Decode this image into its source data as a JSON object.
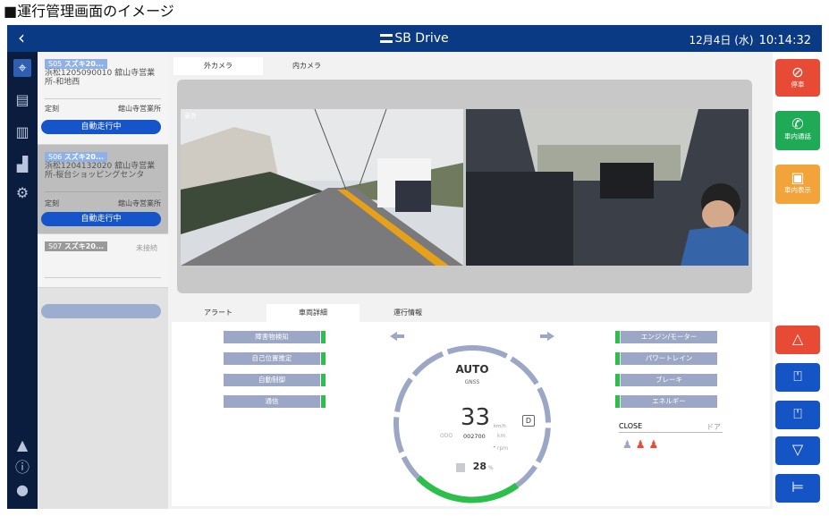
{
  "caption": "■運行管理画面のイメージ",
  "header": {
    "back_icon": "chevron-left-icon",
    "brand": "SB Drive",
    "date": "12月4日 (水)",
    "time": "10:14:32"
  },
  "nav": {
    "icons": [
      "map-route-icon",
      "document-list-icon",
      "document-check-icon",
      "chart-icon",
      "settings-icon"
    ],
    "bottom_icons": [
      "bell-icon",
      "info-icon",
      "user-icon"
    ]
  },
  "vehicles": [
    {
      "id": "S05",
      "model": "スズキ20...",
      "route": "浜松1205090010 舘山寺営業所-和地西",
      "kind": "定刻",
      "depot": "舘山寺営業所",
      "status": "自動走行中",
      "selected": false
    },
    {
      "id": "S06",
      "model": "スズキ20...",
      "route": "浜松1204132020 舘山寺営業所-桜台ショッピングセンタ",
      "kind": "定刻",
      "depot": "舘山寺営業所",
      "status": "自動走行中",
      "selected": true
    },
    {
      "id": "S07",
      "model": "スズキ20...",
      "status": "未接続"
    }
  ],
  "camera": {
    "tabs": [
      "外カメラ",
      "内カメラ"
    ],
    "active_tab": 0,
    "outside_label": "車外"
  },
  "info_tabs": {
    "tabs": [
      "アラート",
      "車両詳細",
      "運行情報"
    ],
    "active_tab": 1
  },
  "alerts": [
    {
      "label": "障害物検知",
      "ok": true
    },
    {
      "label": "自己位置推定",
      "ok": true
    },
    {
      "label": "自動制御",
      "ok": true
    },
    {
      "label": "通信",
      "ok": true
    }
  ],
  "systems": [
    {
      "label": "エンジン/モーター",
      "ok": true
    },
    {
      "label": "パワートレイン",
      "ok": true
    },
    {
      "label": "ブレーキ",
      "ok": true
    },
    {
      "label": "エネルギー",
      "ok": true
    }
  ],
  "door": {
    "state": "CLOSE",
    "label": "ドア"
  },
  "gauge": {
    "mode": "AUTO",
    "positioning": "GNSS",
    "speed": "33",
    "speed_unit": "km/h",
    "gear": "D",
    "odo_label": "ODO",
    "odo_value": "002700",
    "odo_unit": "km",
    "rpm_value": "-",
    "rpm_unit": "rpm",
    "fuel_value": "28",
    "fuel_unit": "%",
    "fuel_level": 0.28
  },
  "right_buttons": {
    "stop": "停車",
    "call": "車内通話",
    "display": "車内表示"
  },
  "right_icons": [
    "hazard-icon",
    "door-left-icon",
    "door-right-icon",
    "wiper-icon",
    "headlight-icon"
  ],
  "colors": {
    "header": "#0b3a84",
    "nav": "#0a1d3e",
    "status_button": "#1555c9",
    "ok": "#2cbf4b",
    "stop": "#e84b35",
    "call": "#1faa55",
    "display": "#f2a33a",
    "control": "#1454c4"
  }
}
